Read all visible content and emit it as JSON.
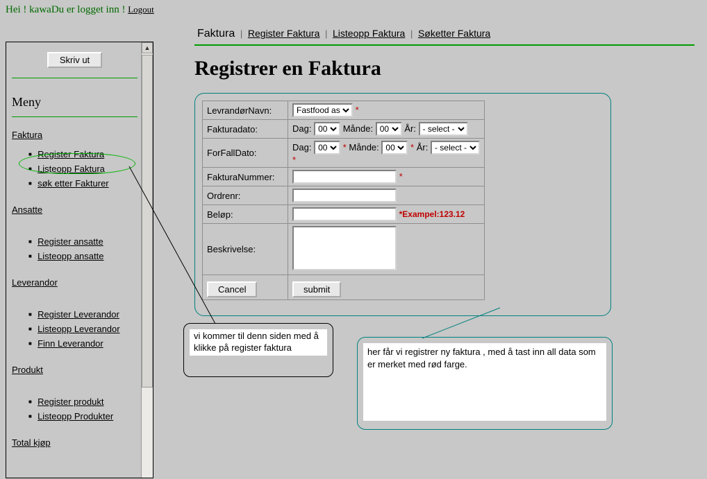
{
  "top": {
    "hei": "Hei ! ",
    "user": "kawa",
    "logged": "Du er logget inn ! ",
    "logout": "Logout"
  },
  "sidebar": {
    "print": "Skriv ut",
    "menu_title": "Meny",
    "sections": [
      {
        "head": "Faktura",
        "items": [
          "Register Faktura",
          "Listeopp Faktura",
          "søk etter Fakturer"
        ]
      },
      {
        "head": "Ansatte",
        "items": [
          "Register ansatte",
          "Listeopp ansatte"
        ]
      },
      {
        "head": "Leverandor",
        "items": [
          "Register Leverandor",
          "Listeopp Leverandor",
          "Finn Leverandor"
        ]
      },
      {
        "head": "Produkt",
        "items": [
          "Register produkt",
          "Listeopp Produkter"
        ]
      },
      {
        "head": "Total kjøp",
        "items": []
      }
    ]
  },
  "tabs": {
    "t0": "Faktura",
    "t1": "Register Faktura",
    "t2": "Listeopp Faktura",
    "t3": "Søketter Faktura"
  },
  "page": {
    "title": "Registrer en Faktura"
  },
  "form": {
    "labels": {
      "leverandor": "LevrandørNavn:",
      "fakturadato": "Fakturadato:",
      "forfall": "ForFallDato:",
      "fakturanr": "FakturaNummer:",
      "ordrenr": "Ordrenr:",
      "belop": "Beløp:",
      "beskrivelse": "Beskrivelse:",
      "dag": "Dag:",
      "mande": "Månde:",
      "ar": "År:"
    },
    "selects": {
      "leverandor": "Fastfood as",
      "dag": "00",
      "mande": "00",
      "ar": "- select -"
    },
    "example": "*Exampel:123.12",
    "cancel": "Cancel",
    "submit": "submit"
  },
  "callouts": {
    "left": "vi kommer til denn siden med å klikke på register faktura",
    "right": "her får vi registrer ny faktura , med å tast inn all data som er merket med rød farge."
  }
}
